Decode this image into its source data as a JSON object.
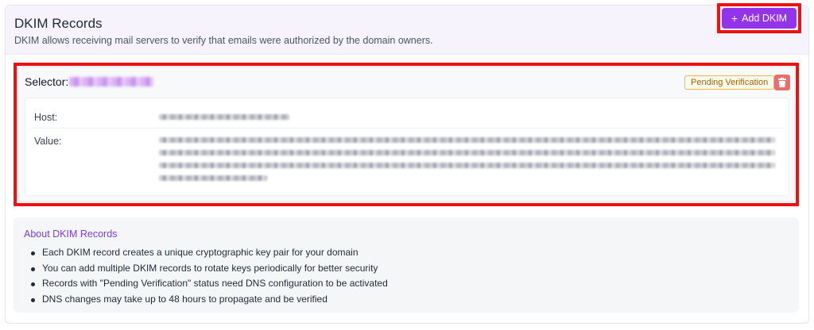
{
  "header": {
    "title": "DKIM Records",
    "subtitle": "DKIM allows receiving mail servers to verify that emails were authorized by the domain owners.",
    "add_button": {
      "icon": "plus-icon",
      "label": "Add DKIM"
    }
  },
  "record": {
    "selector_label": "Selector:",
    "status_badge": "Pending Verification",
    "delete_icon": "trash-icon",
    "host_label": "Host:",
    "value_label": "Value:"
  },
  "about": {
    "title": "About DKIM Records",
    "items": [
      "Each DKIM record creates a unique cryptographic key pair for your domain",
      "You can add multiple DKIM records to rotate keys periodically for better security",
      "Records with \"Pending Verification\" status need DNS configuration to be activated",
      "DNS changes may take up to 48 hours to propagate and be verified"
    ]
  },
  "colors": {
    "accent": "#9333ea",
    "highlight_outline": "#ee1111",
    "pending_badge_text": "#a16207",
    "delete_button": "#e6706b",
    "about_title": "#7c3aed"
  }
}
